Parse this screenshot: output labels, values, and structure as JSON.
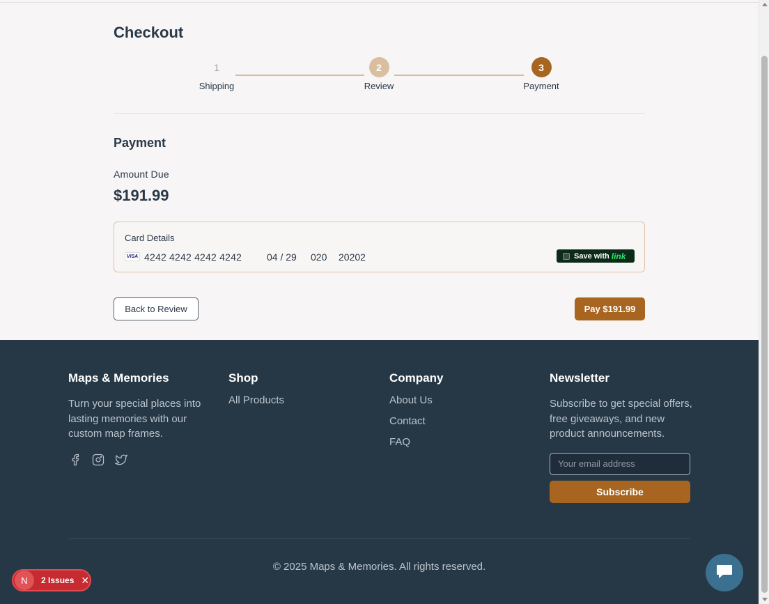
{
  "page": {
    "title": "Checkout"
  },
  "stepper": {
    "steps": [
      {
        "number": "1",
        "label": "Shipping"
      },
      {
        "number": "2",
        "label": "Review"
      },
      {
        "number": "3",
        "label": "Payment"
      }
    ]
  },
  "payment": {
    "title": "Payment",
    "amount_label": "Amount Due",
    "amount_value": "$191.99",
    "card": {
      "title": "Card Details",
      "brand": "VISA",
      "number": "4242 4242 4242 4242",
      "expiry": "04 / 29",
      "cvc": "020",
      "zip": "20202",
      "save_label": "Save with",
      "save_brand": "link"
    },
    "back_label": "Back to Review",
    "pay_label": "Pay $191.99"
  },
  "footer": {
    "brand": {
      "title": "Maps & Memories",
      "description": "Turn your special places into lasting memories with our custom map frames.",
      "socials": [
        "facebook-icon",
        "instagram-icon",
        "twitter-icon"
      ]
    },
    "shop": {
      "title": "Shop",
      "links": [
        "All Products"
      ]
    },
    "company": {
      "title": "Company",
      "links": [
        "About Us",
        "Contact",
        "FAQ"
      ]
    },
    "newsletter": {
      "title": "Newsletter",
      "description": "Subscribe to get special offers, free giveaways, and new product announcements.",
      "placeholder": "Your email address",
      "value": "",
      "button_label": "Subscribe"
    },
    "copyright": "© 2025 Maps & Memories. All rights reserved."
  },
  "issues_badge": {
    "avatar": "N",
    "label": "2 Issues",
    "close": "✕"
  },
  "colors": {
    "accent": "#a8651f",
    "footer_bg": "#263846",
    "issues_red": "#c62b31",
    "link_green": "#2fe36f"
  }
}
